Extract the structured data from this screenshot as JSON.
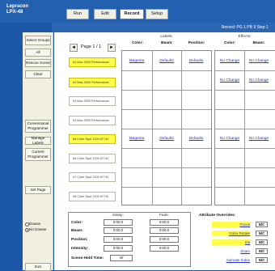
{
  "app": {
    "title": "Lepracon LPX-48"
  },
  "top_tabs": [
    {
      "label": "Run",
      "active": false
    },
    {
      "label": "Edit",
      "active": false
    },
    {
      "label": "Record",
      "active": true
    },
    {
      "label": "Setup",
      "active": false
    }
  ],
  "status": {
    "text": "Record: PG 1 PB 9 Step 1"
  },
  "left_buttons": [
    {
      "label": "Select Groups"
    },
    {
      "label": "All"
    },
    {
      "label": "Rescue Scene"
    },
    {
      "label": "Clear"
    },
    {
      "label": "Conventional Programmer"
    },
    {
      "label": "Manage Labels"
    },
    {
      "label": "Current Programmer"
    },
    {
      "label": "Set Page"
    },
    {
      "label": "Exit"
    }
  ],
  "radios": [
    {
      "label": "Dowse",
      "selected": false
    },
    {
      "label": "No Dowse",
      "selected": true
    }
  ],
  "pager": {
    "prev": "◄",
    "label": "Page 1 / 1",
    "next": "►"
  },
  "presets": [
    {
      "label": "#1 Mac 2000 Performance",
      "selected": true
    },
    {
      "label": "#2 Mac 2000 Performance",
      "selected": true
    },
    {
      "label": "#3 Mac 2000 Performance",
      "selected": false
    },
    {
      "label": "#4 Mac 2000 Performance",
      "selected": false
    },
    {
      "label": "#5 Color Spot 1200 AT HC",
      "selected": true
    },
    {
      "label": "#6 Color Spot 1200 AT HC",
      "selected": false
    },
    {
      "label": "#7 Color Spot 1200 AT HC",
      "selected": false
    },
    {
      "label": "#8 Color Spot 1200 AT HC",
      "selected": false
    }
  ],
  "labels_grid": {
    "group": "Labels:",
    "headers": [
      "Color:",
      "Beam:",
      "Position:"
    ],
    "rows": [
      [
        "Magenta",
        "Defaults",
        "Defaults"
      ],
      [
        "",
        "",
        ""
      ],
      [
        "",
        "",
        ""
      ],
      [
        "",
        "",
        ""
      ],
      [
        "Magenta",
        "Defaults",
        "Defaults"
      ],
      [
        "",
        "",
        ""
      ],
      [
        "",
        "",
        ""
      ],
      [
        "",
        "",
        ""
      ]
    ]
  },
  "effects_grid": {
    "group": "Effects:",
    "headers": [
      "Color:",
      "Beam:"
    ],
    "rows": [
      [
        "No Change",
        "No Change"
      ],
      [
        "No Change",
        "No Change"
      ],
      [
        "",
        ""
      ],
      [
        "",
        ""
      ],
      [
        "No Change",
        "No Change"
      ],
      [
        "",
        ""
      ],
      [
        "",
        ""
      ],
      [
        "",
        ""
      ]
    ]
  },
  "timing": {
    "delay_label": "Delay:",
    "fade_label": "Fade:",
    "rows": [
      {
        "label": "Color:",
        "delay": "0:00.0",
        "fade": "0:00.0"
      },
      {
        "label": "Beam:",
        "delay": "0:00.0",
        "fade": "0:00.0"
      },
      {
        "label": "Position:",
        "delay": "0:00.0",
        "fade": "0:00.0"
      },
      {
        "label": "Intensity:",
        "delay": "0:00.0",
        "fade": "0:00.0"
      }
    ],
    "hold_label": "Scene Hold Time:",
    "hold_value": "Inf"
  },
  "overrides": {
    "title": "Attribute Overrides:",
    "items": [
      {
        "label": "Focus",
        "value": "N/C",
        "highlight": true
      },
      {
        "label": "Gobo Rotate",
        "value": "N/C",
        "highlight": true
      },
      {
        "label": "Iris",
        "value": "N/C",
        "highlight": true
      },
      {
        "label": "Zoom",
        "value": "N/C",
        "highlight": false
      },
      {
        "label": "Animate Index",
        "value": "N/C",
        "highlight": false
      }
    ]
  },
  "colors": {
    "background": "#1d58a8",
    "panel": "#f1efdf",
    "selected": "#fffd4a",
    "link": "#2233cc"
  }
}
